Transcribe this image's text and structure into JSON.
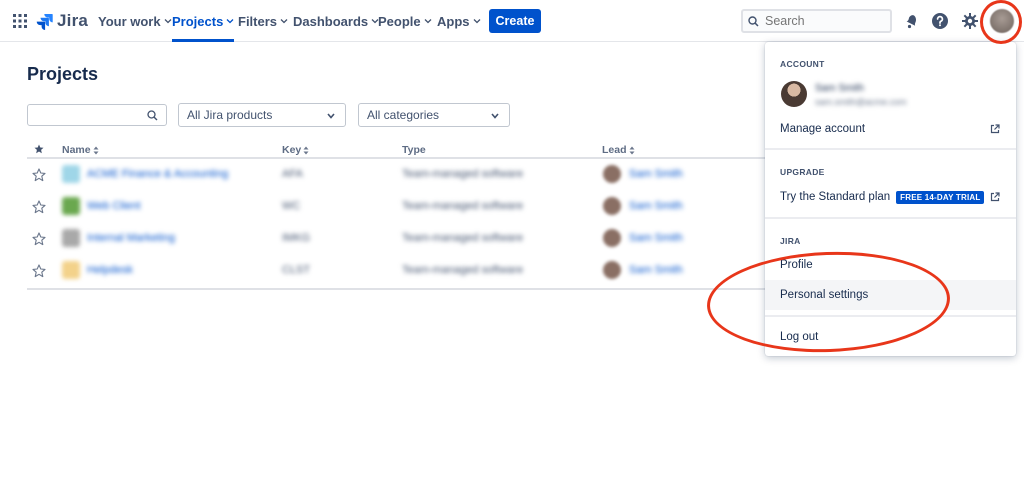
{
  "app": {
    "name": "Jira"
  },
  "nav": {
    "items": [
      {
        "label": "Your work"
      },
      {
        "label": "Projects"
      },
      {
        "label": "Filters"
      },
      {
        "label": "Dashboards"
      },
      {
        "label": "People"
      },
      {
        "label": "Apps"
      }
    ],
    "create_label": "Create",
    "search_placeholder": "Search"
  },
  "page": {
    "title": "Projects",
    "filters": {
      "product_select": "All Jira products",
      "category_select": "All categories"
    },
    "table": {
      "headers": {
        "name": "Name",
        "key": "Key",
        "type": "Type",
        "lead": "Lead"
      },
      "rows": [
        {
          "name": "ACME Finance & Accounting",
          "key": "AFA",
          "type": "Team-managed software",
          "lead": "Sam Smith",
          "thumb_color": "#9fd6e8"
        },
        {
          "name": "Web Client",
          "key": "WC",
          "type": "Team-managed software",
          "lead": "Sam Smith",
          "thumb_color": "#6aa84f"
        },
        {
          "name": "Internal Marketing",
          "key": "IMKG",
          "type": "Team-managed software",
          "lead": "Sam Smith",
          "thumb_color": "#a9a9a9"
        },
        {
          "name": "Helpdesk",
          "key": "CLST",
          "type": "Team-managed software",
          "lead": "Sam Smith",
          "thumb_color": "#f3d28a"
        }
      ]
    }
  },
  "account_menu": {
    "account_heading": "ACCOUNT",
    "user_name": "Sam Smith",
    "user_email": "sam.smith@acme.com",
    "manage_account": "Manage account",
    "upgrade_heading": "UPGRADE",
    "standard_plan": "Try the Standard plan",
    "trial_badge": "FREE 14-DAY TRIAL",
    "jira_heading": "JIRA",
    "profile": "Profile",
    "personal_settings": "Personal settings",
    "log_out": "Log out"
  },
  "colors": {
    "brand": "#0052cc",
    "annotation": "#e8361a"
  }
}
